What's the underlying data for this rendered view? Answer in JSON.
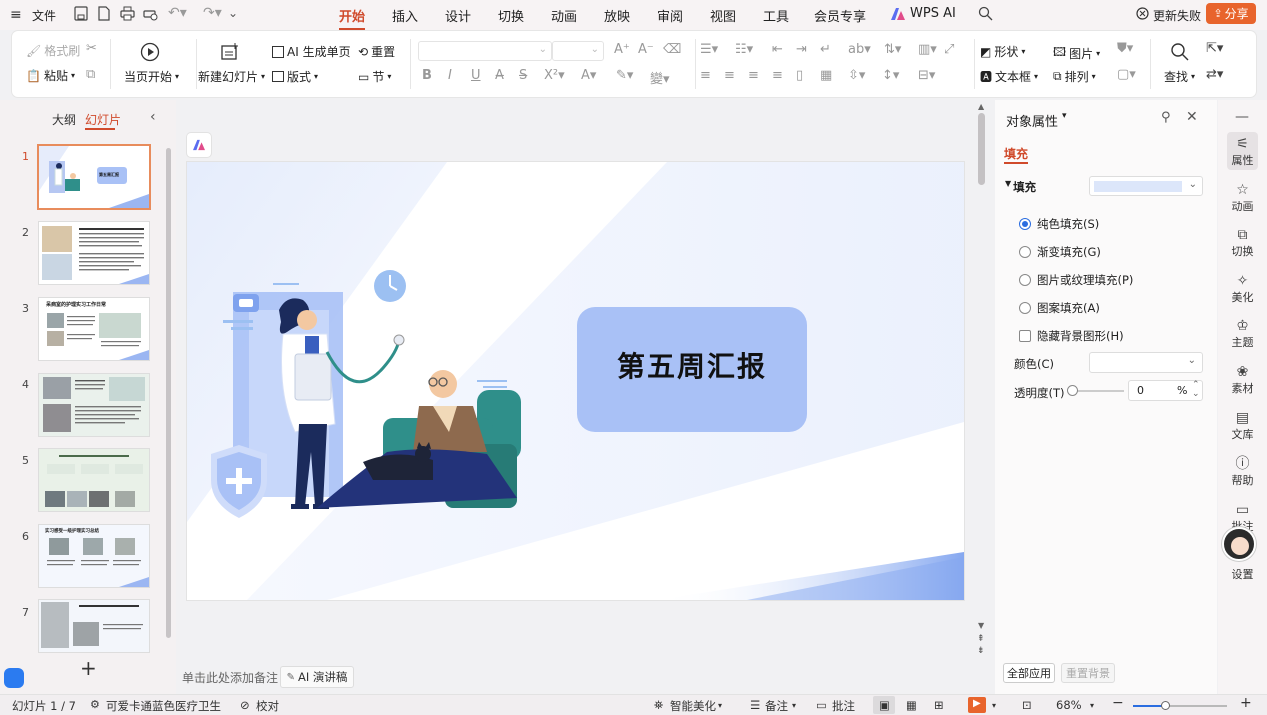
{
  "menubar": {
    "file": "文件",
    "tabs": [
      "开始",
      "插入",
      "设计",
      "切换",
      "动画",
      "放映",
      "审阅",
      "视图",
      "工具",
      "会员专享",
      "WPS AI"
    ],
    "active_tab": "开始",
    "update_failed": "更新失败",
    "share": "分享"
  },
  "ribbon": {
    "format_painter": "格式刷",
    "paste": "粘贴",
    "from_current": "当页开始",
    "new_slide": "新建幻灯片",
    "ai_generate": "AI 生成单页",
    "layout": "版式",
    "reset": "重置",
    "section": "节",
    "shape": "形状",
    "picture": "图片",
    "textbox": "文本框",
    "arrange": "排列",
    "find": "查找"
  },
  "left_panel": {
    "tab_outline": "大纲",
    "tab_slides": "幻灯片",
    "slide_numbers": [
      "1",
      "2",
      "3",
      "4",
      "5",
      "6",
      "7"
    ],
    "thumb_titles": {
      "s1": "第五周汇报",
      "s3": "呆病室的护理实习工作日常",
      "s6": "实习感受一级护理实习总结"
    },
    "add_symbol": "+"
  },
  "slide": {
    "title": "第五周汇报"
  },
  "notes": {
    "placeholder": "单击此处添加备注",
    "ai_speech": "AI 演讲稿"
  },
  "right_panel": {
    "title": "对象属性",
    "tab_fill": "填充",
    "fill_section": "填充",
    "options": [
      "纯色填充(S)",
      "渐变填充(G)",
      "图片或纹理填充(P)",
      "图案填充(A)"
    ],
    "selected_option": 0,
    "hide_bg": "隐藏背景图形(H)",
    "color_label": "颜色(C)",
    "transparency_label": "透明度(T)",
    "transparency_value": "0",
    "percent": "%",
    "apply_all": "全部应用",
    "reset_bg": "重置背景"
  },
  "sidebar": {
    "items": [
      "属性",
      "动画",
      "切换",
      "美化",
      "主题",
      "素材",
      "文库",
      "帮助",
      "批注",
      "设置"
    ]
  },
  "status": {
    "slide_info": "幻灯片 1 / 7",
    "theme": "可爱卡通蓝色医疗卫生",
    "proof": "校对",
    "smart": "智能美化",
    "notes": "备注",
    "comments": "批注",
    "zoom": "68%"
  },
  "colors": {
    "accent": "#d04a2b",
    "share_btn": "#e8642c",
    "title_box": "#a9c1f6",
    "slide_blue": "#86a8f0"
  }
}
